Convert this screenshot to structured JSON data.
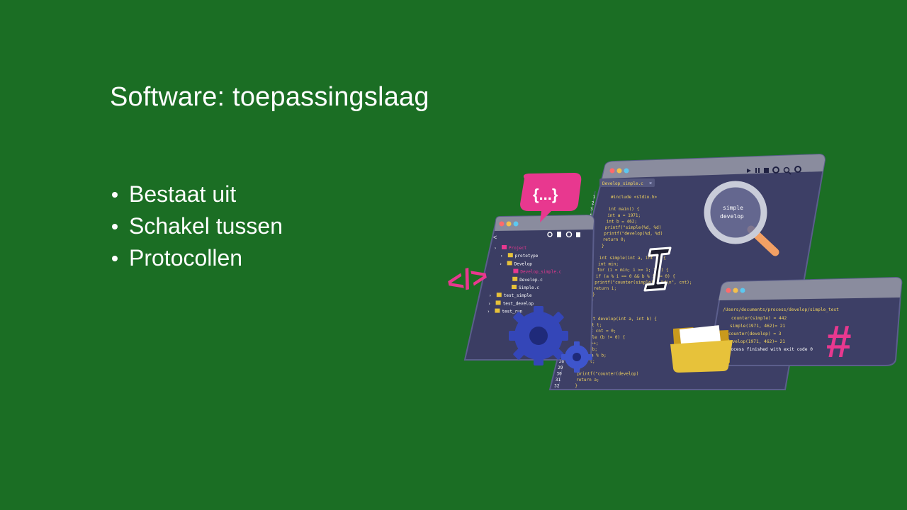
{
  "slide": {
    "title": "Software: toepassingslaag",
    "bullets": [
      "Bestaat uit",
      "Schakel tussen",
      "Protocollen"
    ]
  },
  "illustration": {
    "editor_tab": "Develop_simple.c",
    "explorer_items": [
      "Project",
      "prototype",
      "Develop",
      "Develop_simple.c",
      "Develop.c",
      "Simple.c",
      "test_simple",
      "test_develop",
      "test_run"
    ],
    "code_lines": [
      "#include <stdio.h>",
      "",
      "int main() {",
      "  int a = 1971;",
      "  int b = 462;",
      "  printf(\"simple(%d, %d)",
      "  printf(\"develop(%d, %d)",
      "  return 0;",
      "}",
      "",
      "int simple(int a, int b) {",
      "  int min;",
      "  for (i = min; i >= 1; i--) {",
      "    if (a % i == 0 && b % i == 0) {",
      "      printf(\"counter(simple) = %d\\n\", cnt);",
      "      return i;",
      "    }",
      "  }",
      "}",
      "",
      "int develop(int a, int b) {",
      "  int t;",
      "  int cnt = 0;",
      "  while (b != 0) {",
      "    cnt++;",
      "    t = b;",
      "    b = a % b;",
      "    a = t;",
      "  }",
      "  printf(\"counter(develop)",
      "  return a;",
      "}"
    ],
    "terminal_path": "/Users/documents/process/develop/simple_test",
    "terminal_lines": [
      "counter(simple) = 442",
      "simple(1971, 462)= 21",
      "counter(develop) = 3",
      "develop(1971, 462)= 21",
      "Process finished with exit code 0"
    ],
    "magnifier_text": [
      "simple",
      "develop"
    ],
    "code_badge": "{...}",
    "tag_badge": "</>",
    "hash_badge": "#",
    "colors": {
      "background": "#1b6e24",
      "panel": "#3d3f66",
      "panel_dark": "#2e3052",
      "pink": "#e8388f",
      "blue": "#3446b8",
      "folder": "#e7c23a",
      "code_text": "#f2d35e"
    }
  }
}
